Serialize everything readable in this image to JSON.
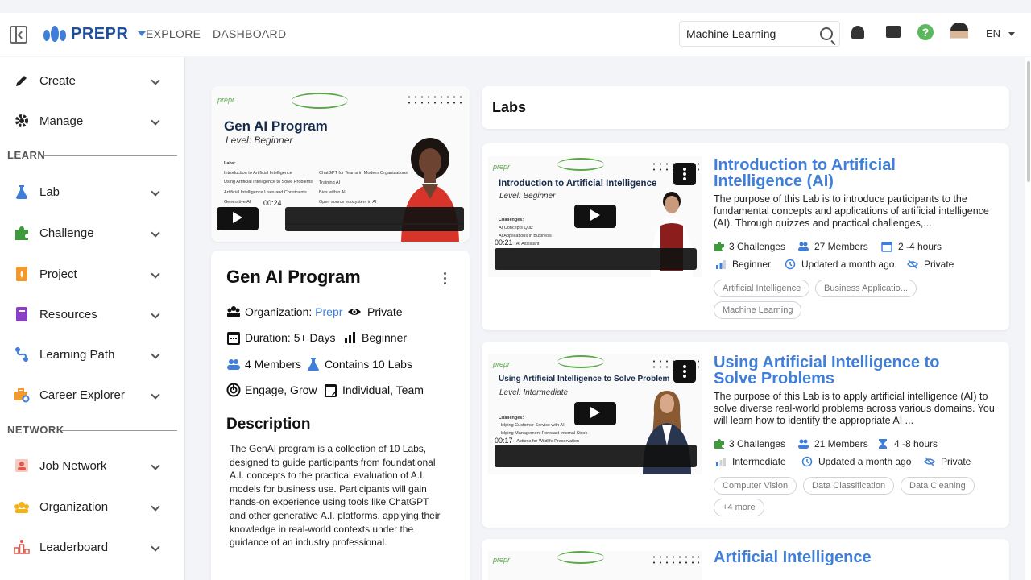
{
  "header": {
    "brand": "PREPR",
    "nav": [
      "EXPLORE",
      "DASHBOARD"
    ],
    "search_value": "Machine Learning",
    "language": "EN"
  },
  "sidebar": {
    "items_top": [
      {
        "label": "Create",
        "icon": "pencil-icon"
      },
      {
        "label": "Manage",
        "icon": "gear-icon"
      }
    ],
    "learn_label": "LEARN",
    "learn_items": [
      {
        "label": "Lab",
        "icon": "flask-icon"
      },
      {
        "label": "Challenge",
        "icon": "puzzle-icon"
      },
      {
        "label": "Project",
        "icon": "project-icon"
      },
      {
        "label": "Resources",
        "icon": "book-icon"
      },
      {
        "label": "Learning Path",
        "icon": "path-icon"
      },
      {
        "label": "Career Explorer",
        "icon": "briefcase-icon"
      }
    ],
    "network_label": "NETWORK",
    "network_items": [
      {
        "label": "Job Network",
        "icon": "job-network-icon"
      },
      {
        "label": "Organization",
        "icon": "organization-icon"
      },
      {
        "label": "Leaderboard",
        "icon": "leaderboard-icon"
      }
    ]
  },
  "program": {
    "video": {
      "brand": "prepr",
      "title": "Gen AI Program",
      "level": "Level: Beginner",
      "labs_heading": "Labs:",
      "labs_col1": [
        "Introduction to Artificial Intelligence",
        "Using Artificial Intelligence to Solve Problems",
        "Artificial Intelligence Uses and Constraints",
        "Generative AI"
      ],
      "labs_col2": [
        "ChatGPT for Teams in Modern Organizations",
        "Training AI",
        "Bias within AI",
        "Open source ecosystem in AI"
      ],
      "time": "00:24"
    },
    "title": "Gen AI Program",
    "organization_label": "Organization:",
    "organization_value": "Prepr",
    "visibility": "Private",
    "duration": "Duration: 5+ Days",
    "level": "Beginner",
    "members": "4 Members",
    "labs_count": "Contains 10 Labs",
    "engage": "Engage, Grow",
    "team": "Individual, Team",
    "description_title": "Description",
    "description": "The GenAI program is a collection of 10 Labs, designed to guide participants from foundational A.I. concepts to the practical evaluation of A.I. models for business use. Participants will gain hands-on experience using tools like ChatGPT and other generative A.I. platforms, applying their knowledge in real-world contexts under the guidance of an industry professional."
  },
  "labs": {
    "heading": "Labs",
    "items": [
      {
        "video_title": "Introduction to Artificial Intelligence",
        "video_level": "Level: Beginner",
        "video_challenges_heading": "Challenges:",
        "video_challenges": [
          "AI Concepts Quiz",
          "AI Applications in Business",
          "...a local AI Assistant"
        ],
        "time": "00:21",
        "title": "Introduction to Artificial Intelligence (AI)",
        "description": "The purpose of this Lab is to introduce participants to the fundamental concepts and applications of artificial intelligence (AI). Through quizzes and practical challenges,...",
        "challenges": "3 Challenges",
        "members": "27 Members",
        "duration": "2 -4 hours",
        "level": "Beginner",
        "updated": "Updated a month ago",
        "visibility": "Private",
        "tags": [
          "Artificial Intelligence",
          "Business Applicatio...",
          "Machine Learning"
        ]
      },
      {
        "video_title": "Using Artificial Intelligence to Solve Problem",
        "video_level": "Level: Intermediate",
        "video_challenges_heading": "Challenges:",
        "video_challenges": [
          "Helping Customer Service with AI",
          "Helping Management Forecast Internal Stock",
          "...ending Actions for Wildlife Preservation"
        ],
        "time": "00:17",
        "title": "Using Artificial Intelligence to Solve Problems",
        "description": "The purpose of this Lab is to apply artificial intelligence (AI) to solve diverse real-world problems across various domains. You will learn how to identify the appropriate AI ...",
        "challenges": "3 Challenges",
        "members": "21 Members",
        "duration": "4 -8 hours",
        "level": "Intermediate",
        "updated": "Updated a month ago",
        "visibility": "Private",
        "tags": [
          "Computer Vision",
          "Data Classification",
          "Data Cleaning",
          "+4 more"
        ]
      },
      {
        "title": "Artificial Intelligence"
      }
    ]
  },
  "colors": {
    "accent": "#3f7fd9",
    "brand_green": "#5aa84a",
    "background": "#f3f4f8"
  }
}
